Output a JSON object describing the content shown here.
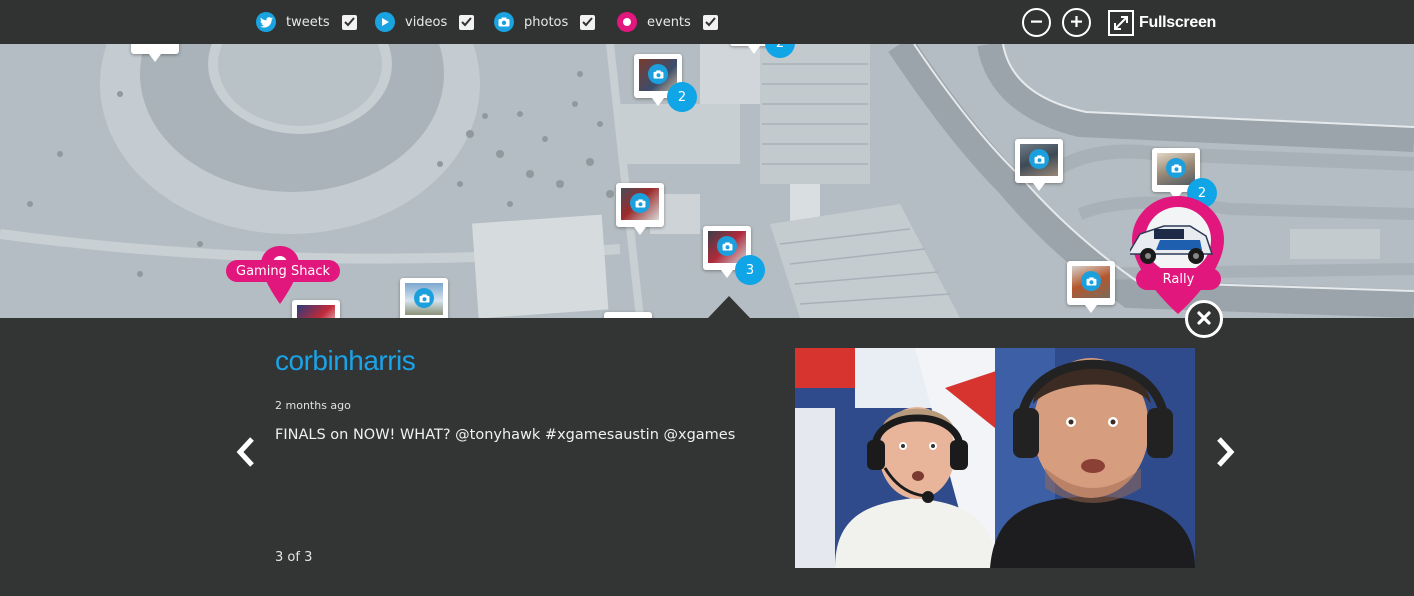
{
  "filters": [
    {
      "label": "tweets",
      "icon": "twitter-bird-icon",
      "checked": true,
      "color": "#19a3e0"
    },
    {
      "label": "videos",
      "icon": "play-icon",
      "checked": true,
      "color": "#19a3e0"
    },
    {
      "label": "photos",
      "icon": "camera-icon",
      "checked": true,
      "color": "#19a3e0"
    },
    {
      "label": "events",
      "icon": "event-dot-icon",
      "checked": true,
      "color": "#e2177e"
    }
  ],
  "controls": {
    "zoom_out_icon": "minus-icon",
    "zoom_in_icon": "plus-icon",
    "fullscreen_label": "Fullscreen"
  },
  "map": {
    "clusters": [
      "2",
      "2",
      "3",
      "2"
    ],
    "events": [
      "Gaming Shack",
      "Rally"
    ]
  },
  "post": {
    "username": "corbinharris",
    "time_ago": "2 months ago",
    "message": "FINALS on NOW! WHAT? @tonyhawk #xgamesaustin @xgames",
    "pager": "3 of 3"
  },
  "colors": {
    "accent_blue": "#1aa3e8",
    "event_pink": "#e2177e",
    "panel_bg": "#333535"
  }
}
